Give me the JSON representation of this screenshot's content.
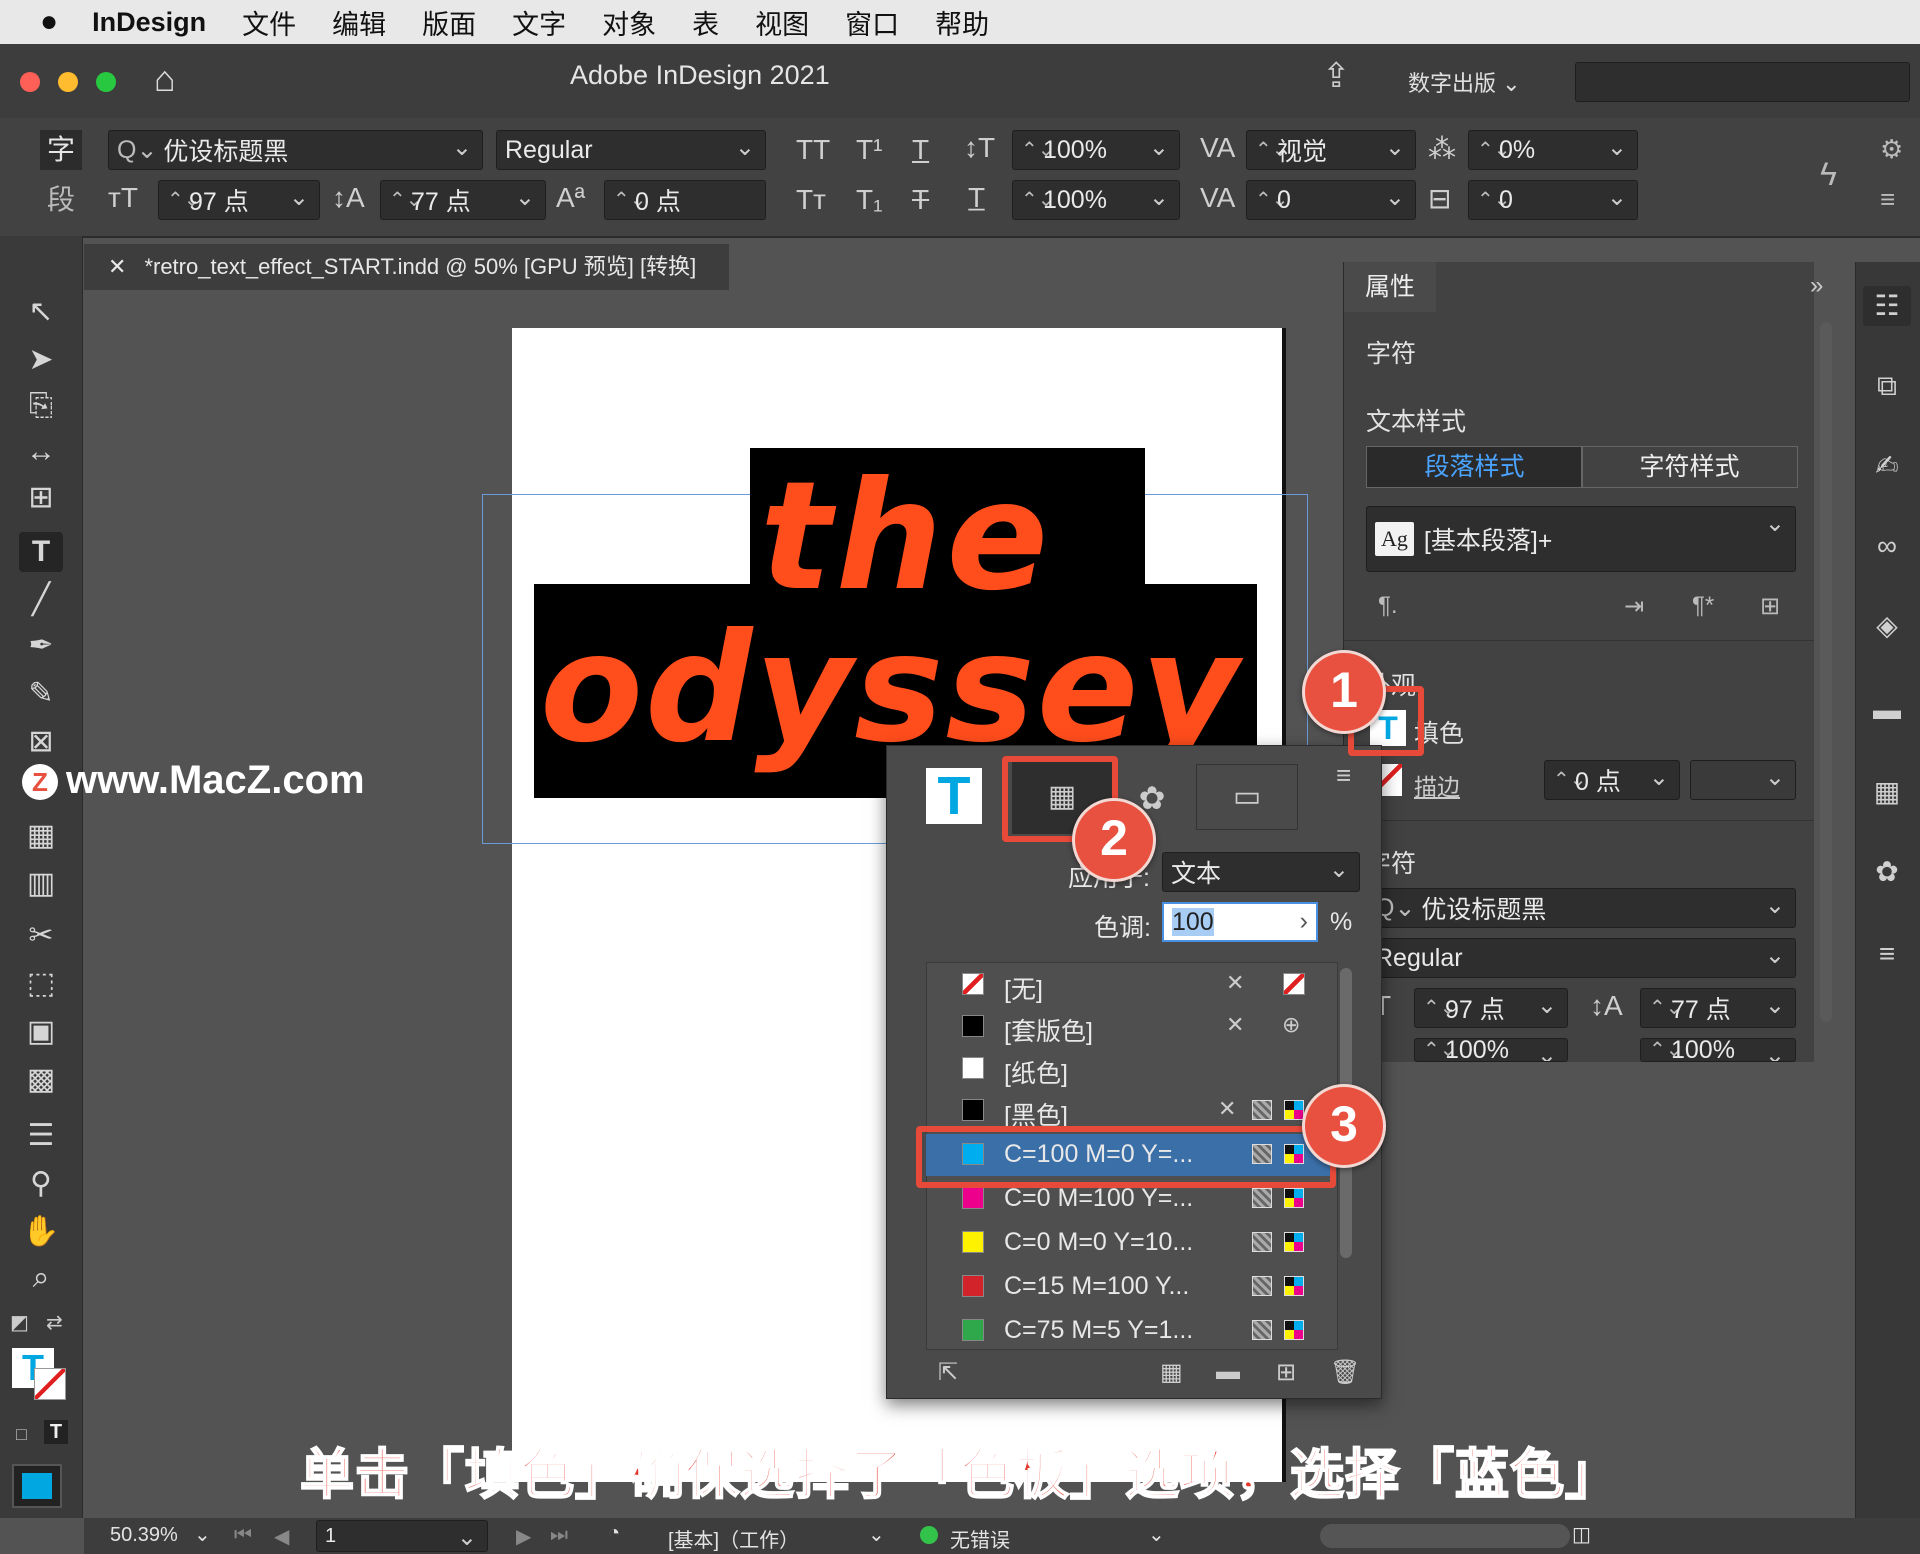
{
  "menubar": {
    "app": "InDesign",
    "items": [
      "文件",
      "编辑",
      "版面",
      "文字",
      "对象",
      "表",
      "视图",
      "窗口",
      "帮助"
    ]
  },
  "window": {
    "title": "Adobe InDesign 2021",
    "workspace": "数字出版"
  },
  "control": {
    "char_label": "字",
    "para_label": "段",
    "font": "优设标题黑",
    "style": "Regular",
    "size": "97 点",
    "leading": "77 点",
    "baseline": "0 点",
    "vscale": "100%",
    "hscale": "100%",
    "kerning": "视觉",
    "tracking": "0",
    "tsume": "0%",
    "grid": "0"
  },
  "document": {
    "tab": "*retro_text_effect_START.indd @ 50% [GPU 预览] [转换]",
    "line1": "the",
    "line2": "odyssey"
  },
  "properties": {
    "tab": "属性",
    "section_char": "字符",
    "text_styles": "文本样式",
    "para_style_tab": "段落样式",
    "char_style_tab": "字符样式",
    "current_style": "[基本段落]+",
    "appearance": "外观",
    "fill": "填色",
    "stroke": "描边",
    "stroke_weight": "0 点",
    "char_section": "字符",
    "font": "优设标题黑",
    "style": "Regular",
    "size": "97 点",
    "leading": "77 点",
    "scale1": "100%",
    "scale2": "100%"
  },
  "swatches": {
    "apply_label": "应用于:",
    "apply_value": "文本",
    "tint_label": "色调:",
    "tint_value": "100",
    "tint_unit": "%",
    "items": [
      {
        "name": "[无]",
        "color": "none"
      },
      {
        "name": "[套版色]",
        "color": "#000000"
      },
      {
        "name": "[纸色]",
        "color": "#ffffff"
      },
      {
        "name": "[黑色]",
        "color": "#000000"
      },
      {
        "name": "C=100 M=0 Y=...",
        "color": "#00aeef"
      },
      {
        "name": "C=0 M=100 Y=...",
        "color": "#ec008c"
      },
      {
        "name": "C=0 M=0 Y=10...",
        "color": "#fff200"
      },
      {
        "name": "C=15 M=100 Y...",
        "color": "#d2232a"
      },
      {
        "name": "C=75 M=5 Y=1...",
        "color": "#2ea84a"
      }
    ]
  },
  "status": {
    "zoom": "50.39%",
    "page": "1",
    "profile": "[基本]（工作）",
    "errors": "无错误"
  },
  "annotations": {
    "badge1": "1",
    "badge2": "2",
    "badge3": "3",
    "caption": "单击「填色」确保选择了「色板」选项，选择「蓝色」",
    "watermark": "www.MacZ.com"
  },
  "colors": {
    "accent_orange": "#ff4d1c",
    "annotation_red": "#e84a3a",
    "selected_row": "#3b6fa8"
  }
}
